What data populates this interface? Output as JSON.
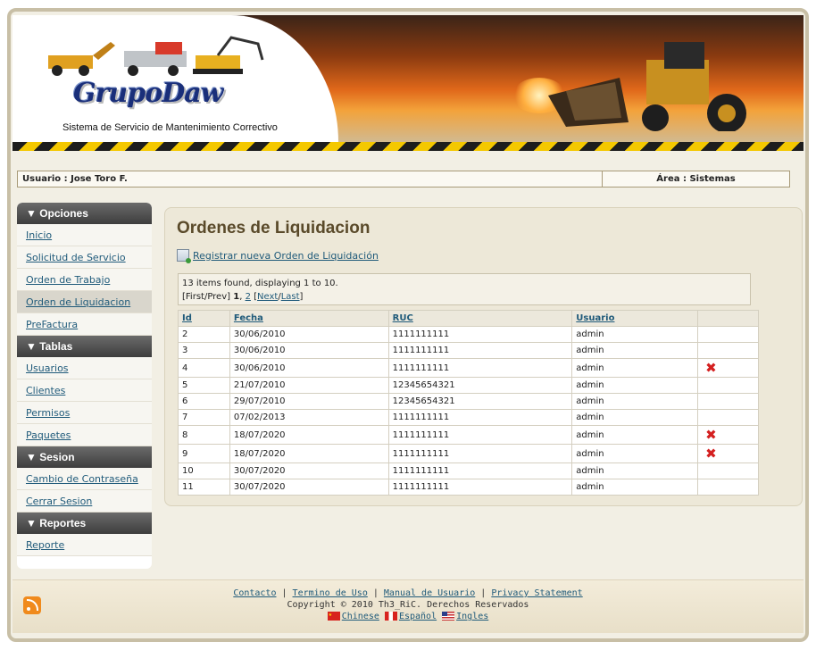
{
  "header": {
    "logo_text": "GrupoDaw",
    "subtitle": "Sistema de Servicio de Mantenimiento Correctivo"
  },
  "userbar": {
    "user": "Usuario : Jose Toro F.",
    "area": "Área : Sistemas"
  },
  "sidebar": {
    "sections": [
      {
        "title": "▼ Opciones",
        "items": [
          "Inicio",
          "Solicitud de Servicio",
          "Orden de Trabajo",
          "Orden de Liquidacion",
          "PreFactura"
        ]
      },
      {
        "title": "▼ Tablas",
        "items": [
          "Usuarios",
          "Clientes",
          "Permisos",
          "Paquetes"
        ]
      },
      {
        "title": "▼ Sesion",
        "items": [
          "Cambio de Contraseña",
          "Cerrar Sesion"
        ]
      },
      {
        "title": "▼ Reportes",
        "items": [
          "Reporte"
        ]
      }
    ],
    "active_item": "Orden de Liquidacion"
  },
  "main": {
    "title": "Ordenes de Liquidacion",
    "new_link": "Registrar nueva Orden de Liquidación",
    "pager": {
      "summary": "13 items found, displaying 1 to 10.",
      "first_prev": "[First/Prev]",
      "page1": "1",
      "page2": "2",
      "next": "Next",
      "last": "Last"
    },
    "columns": [
      "Id",
      "Fecha",
      "RUC",
      "Usuario"
    ],
    "rows": [
      {
        "id": "2",
        "fecha": "30/06/2010",
        "ruc": "1111111111",
        "usuario": "admin",
        "deletable": false
      },
      {
        "id": "3",
        "fecha": "30/06/2010",
        "ruc": "1111111111",
        "usuario": "admin",
        "deletable": false
      },
      {
        "id": "4",
        "fecha": "30/06/2010",
        "ruc": "1111111111",
        "usuario": "admin",
        "deletable": true
      },
      {
        "id": "5",
        "fecha": "21/07/2010",
        "ruc": "12345654321",
        "usuario": "admin",
        "deletable": false
      },
      {
        "id": "6",
        "fecha": "29/07/2010",
        "ruc": "12345654321",
        "usuario": "admin",
        "deletable": false
      },
      {
        "id": "7",
        "fecha": "07/02/2013",
        "ruc": "1111111111",
        "usuario": "admin",
        "deletable": false
      },
      {
        "id": "8",
        "fecha": "18/07/2020",
        "ruc": "1111111111",
        "usuario": "admin",
        "deletable": true
      },
      {
        "id": "9",
        "fecha": "18/07/2020",
        "ruc": "1111111111",
        "usuario": "admin",
        "deletable": true
      },
      {
        "id": "10",
        "fecha": "30/07/2020",
        "ruc": "1111111111",
        "usuario": "admin",
        "deletable": false
      },
      {
        "id": "11",
        "fecha": "30/07/2020",
        "ruc": "1111111111",
        "usuario": "admin",
        "deletable": false
      }
    ],
    "delete_icon": "delete-x-icon"
  },
  "footer": {
    "links": [
      "Contacto",
      "Termino de Uso",
      "Manual de Usuario",
      "Privacy Statement"
    ],
    "copyright": "Copyright © 2010 Th3_RiC. Derechos Reservados",
    "languages": [
      "Chinese",
      "Español",
      "Ingles"
    ]
  },
  "colors": {
    "link": "#1f5a7a",
    "delete": "#d42020",
    "sidebar_header": "#3d3d3d"
  }
}
